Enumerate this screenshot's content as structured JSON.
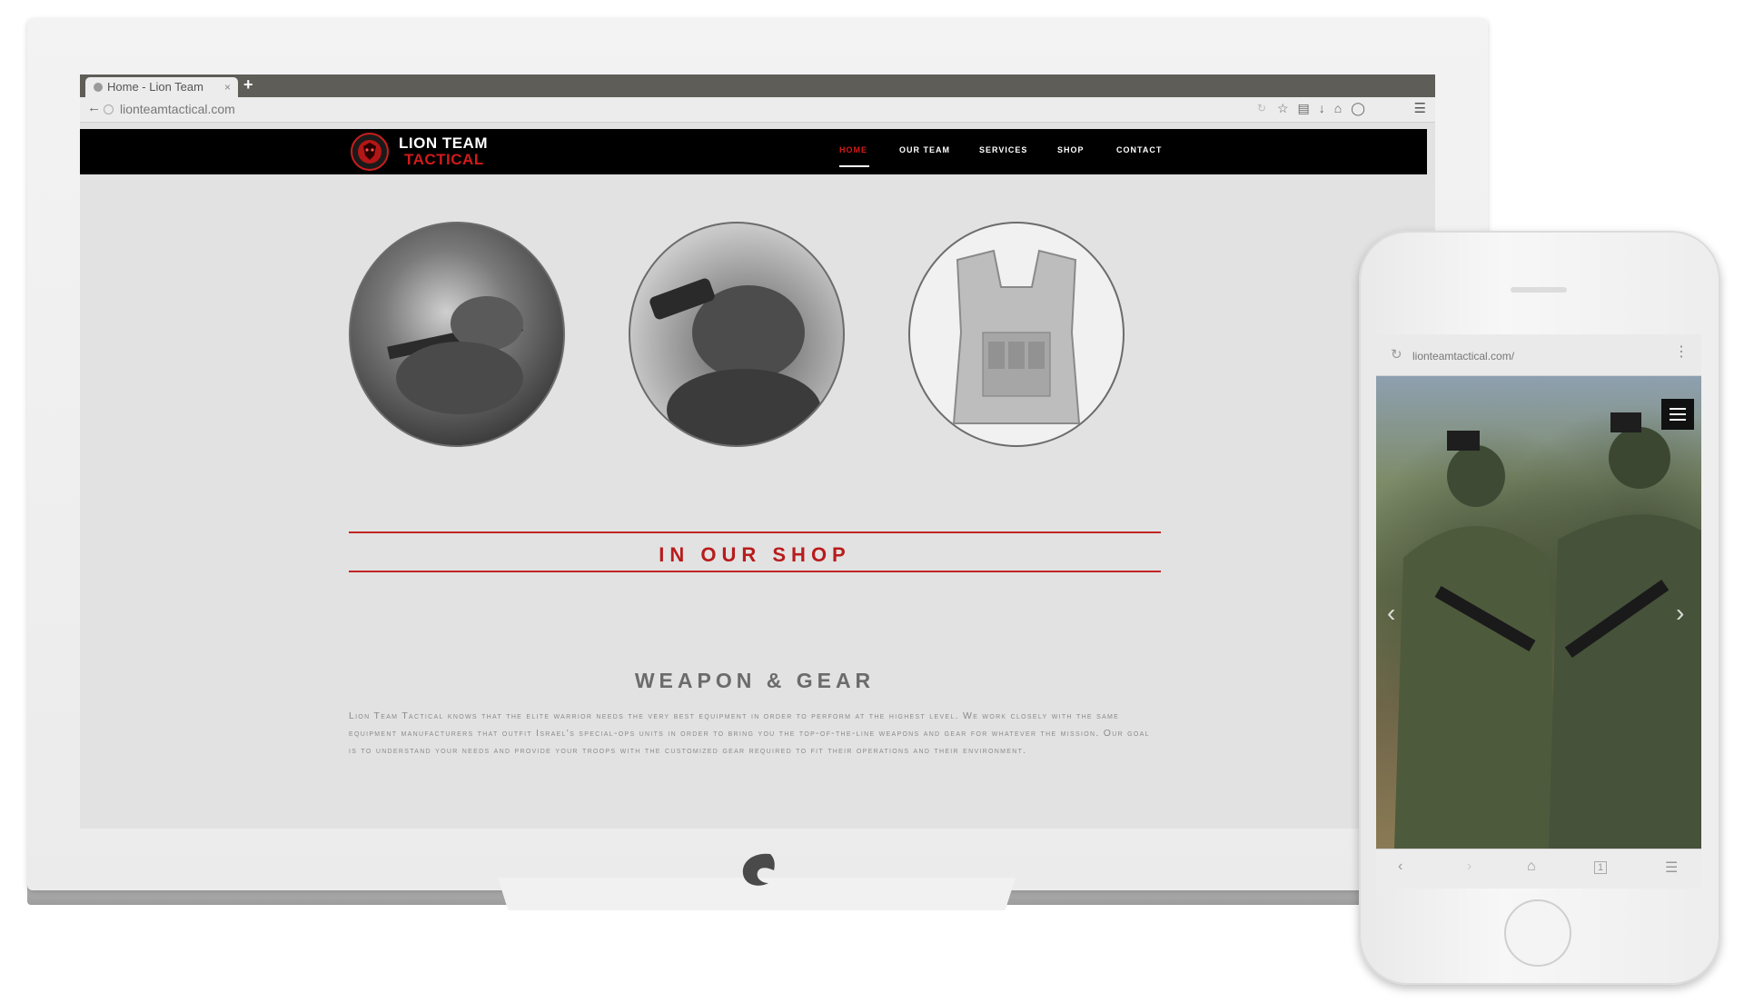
{
  "browser": {
    "tab_title": "Home - Lion Team",
    "tab_close": "×",
    "new_tab": "+",
    "url": "lionteamtactical.com"
  },
  "site": {
    "logo_line1": "LION TEAM",
    "logo_line2": "TACTICAL",
    "nav": [
      "HOME",
      "OUR TEAM",
      "SERVICES",
      "SHOP",
      "CONTACT"
    ],
    "shop_heading": "IN OUR SHOP",
    "section_title": "WEAPON & GEAR",
    "body": "Lion Team Tactical knows that the elite warrior needs the very best equipment in order to perform at the highest level. We work closely with the same equipment manufacturers that outfit Israel's special-ops units in order to bring you the top-of-the-line weapons and gear for whatever the mission. Our goal is to understand your needs and provide your troops with the customized gear required to fit their operations and their environment."
  },
  "mobile": {
    "url": "lionteamtactical.com/",
    "tab_count": "1"
  },
  "colors": {
    "accent_red": "#c22424",
    "header_black": "#000000"
  }
}
